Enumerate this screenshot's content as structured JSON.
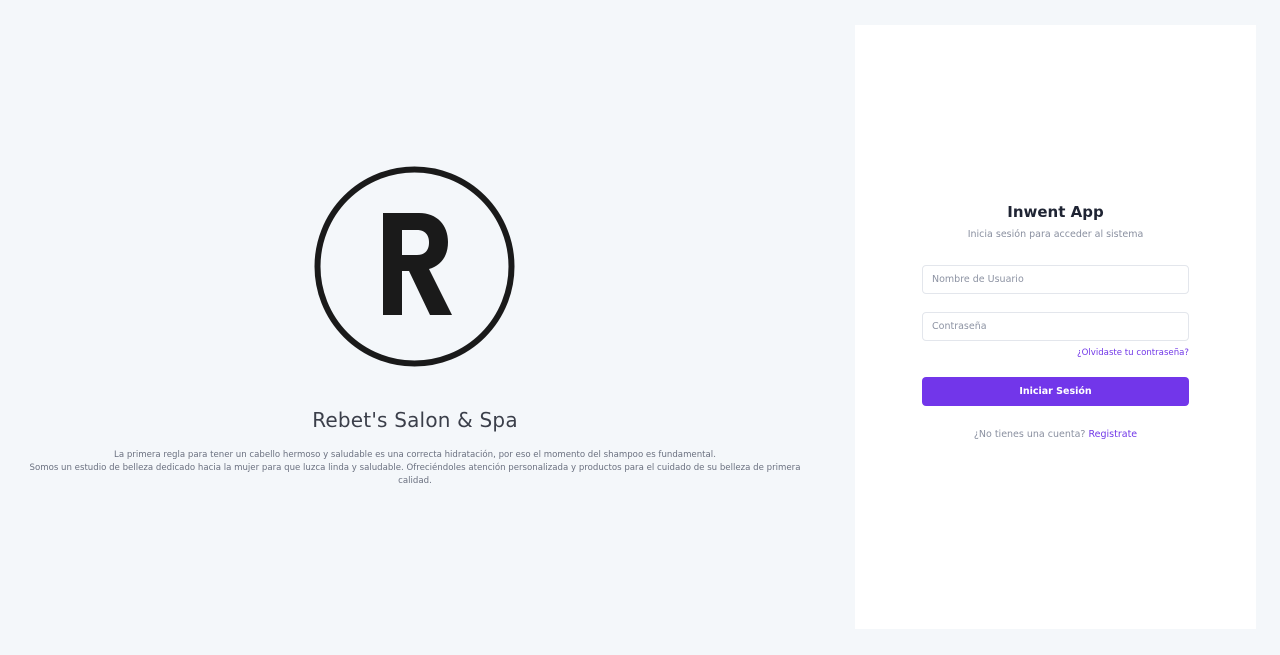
{
  "brand": {
    "title": "Rebet's Salon & Spa",
    "description_line1": "La primera regla para tener un cabello hermoso y saludable es una correcta hidratación, por eso el momento del shampoo es fundamental.",
    "description_line2": "Somos un estudio de belleza dedicado hacia la mujer para que luzca linda y saludable. Ofreciéndoles atención personalizada y productos para el cuidado de su belleza de primera calidad.",
    "logo_icon": "registered-r-icon"
  },
  "login": {
    "title": "Inwent App",
    "subtitle": "Inicia sesión para acceder al sistema",
    "username_placeholder": "Nombre de Usuario",
    "password_placeholder": "Contraseña",
    "forgot_label": "¿Olvidaste tu contraseña?",
    "submit_label": "Iniciar Sesión",
    "signup_prompt": "¿No tienes una cuenta?",
    "signup_link": "Registrate"
  },
  "colors": {
    "accent": "#7236ea",
    "page_bg": "#f4f7fa",
    "card_bg": "#ffffff"
  }
}
